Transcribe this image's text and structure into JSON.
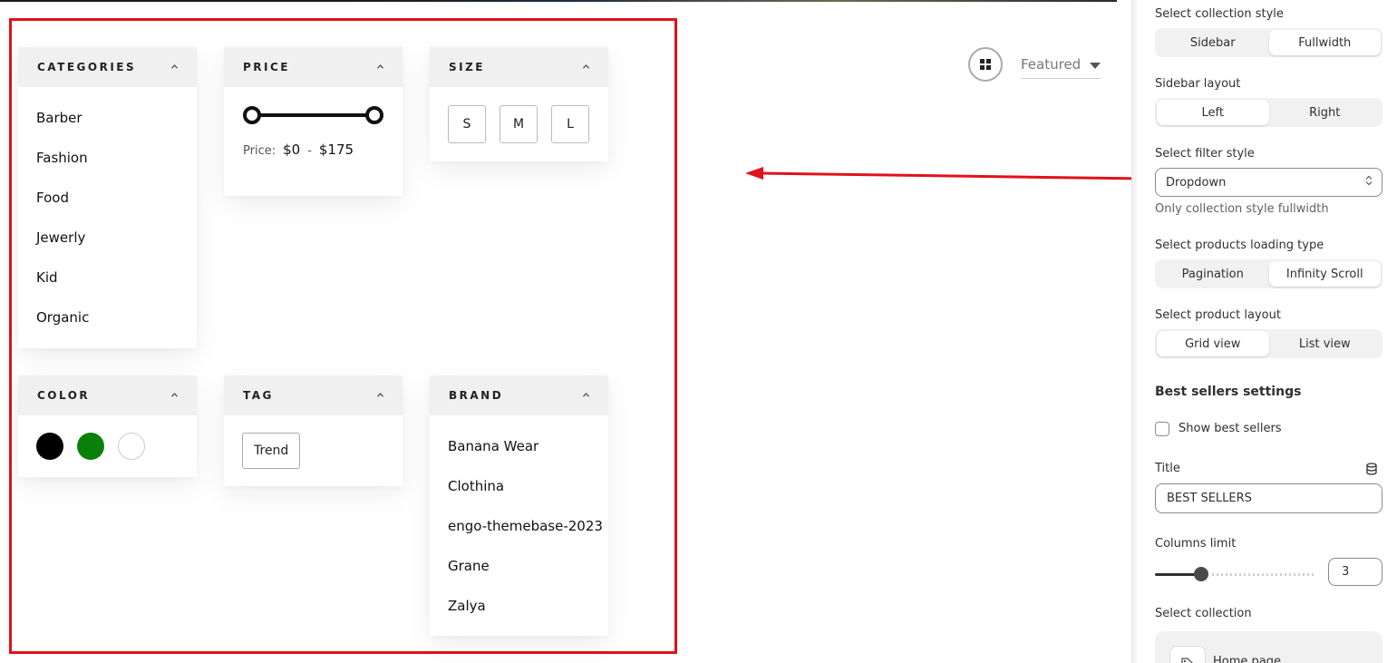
{
  "preview": {
    "categories": {
      "title": "CATEGORIES",
      "items": [
        "Barber",
        "Fashion",
        "Food",
        "Jewerly",
        "Kid",
        "Organic"
      ]
    },
    "price": {
      "title": "PRICE",
      "label": "Price:",
      "min": "$0",
      "separator": "-",
      "max": "$175"
    },
    "size": {
      "title": "SIZE",
      "options": [
        "S",
        "M",
        "L"
      ]
    },
    "color": {
      "title": "COLOR",
      "swatches": [
        "#000000",
        "#0a7f0a",
        "#ffffff"
      ]
    },
    "tag": {
      "title": "TAG",
      "items": [
        "Trend"
      ]
    },
    "brand": {
      "title": "BRAND",
      "items": [
        "Banana Wear",
        "Clothina",
        "engo-themebase-2023",
        "Grane",
        "Zalya"
      ]
    },
    "toolbar": {
      "sort_label": "Featured",
      "grid_icon": "grid-icon"
    }
  },
  "settings": {
    "collection_style": {
      "label": "Select collection style",
      "options": [
        "Sidebar",
        "Fullwidth"
      ],
      "selected": "Fullwidth"
    },
    "sidebar_layout": {
      "label": "Sidebar layout",
      "options": [
        "Left",
        "Right"
      ],
      "selected": "Left"
    },
    "filter_style": {
      "label": "Select filter style",
      "value": "Dropdown",
      "help": "Only collection style fullwidth"
    },
    "loading_type": {
      "label": "Select products loading type",
      "options": [
        "Pagination",
        "Infinity Scroll"
      ],
      "selected": "Infinity Scroll"
    },
    "product_layout": {
      "label": "Select product layout",
      "options": [
        "Grid view",
        "List view"
      ],
      "selected": "Grid view"
    },
    "best_sellers": {
      "heading": "Best sellers settings",
      "show_label": "Show best sellers",
      "show_checked": false,
      "title_label": "Title",
      "title_value": "BEST SELLERS",
      "columns_label": "Columns limit",
      "columns_value": "3",
      "columns_fraction": 0.27
    },
    "collection": {
      "label": "Select collection",
      "name": "Home page"
    }
  },
  "colors": {
    "annotation": "#e0121b",
    "accent_green": "#0a7f0a"
  }
}
